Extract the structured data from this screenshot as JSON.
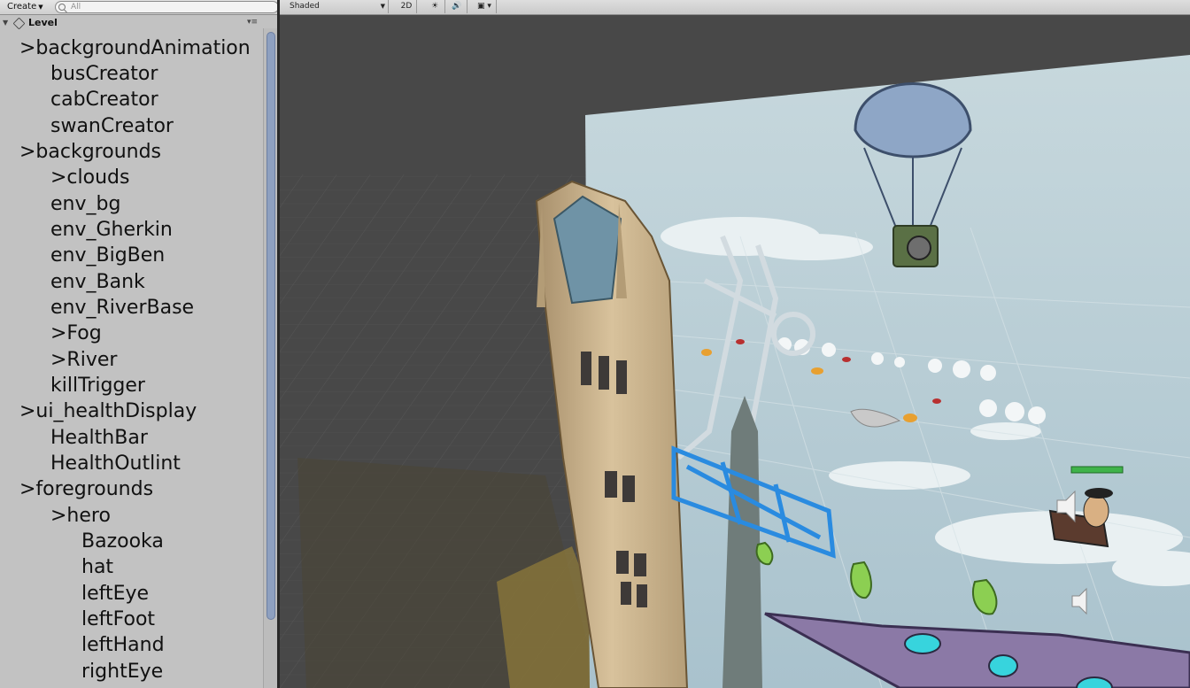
{
  "hierarchy": {
    "create_label": "Create",
    "search_placeholder": "All",
    "scene_name": "Level",
    "items": [
      {
        "label": ">backgroundAnimation"
      },
      {
        "label": "busCreator"
      },
      {
        "label": "cabCreator"
      },
      {
        "label": "swanCreator"
      },
      {
        "label": ">backgrounds"
      },
      {
        "label": ">clouds"
      },
      {
        "label": "env_bg"
      },
      {
        "label": "env_Gherkin"
      },
      {
        "label": "env_BigBen"
      },
      {
        "label": "env_Bank"
      },
      {
        "label": "env_RiverBase"
      },
      {
        "label": ">Fog"
      },
      {
        "label": ">River"
      },
      {
        "label": "killTrigger"
      },
      {
        "label": ">ui_healthDisplay"
      },
      {
        "label": "HealthBar"
      },
      {
        "label": "HealthOutlint"
      },
      {
        "label": ">foregrounds"
      },
      {
        "label": ">hero"
      },
      {
        "label": "Bazooka"
      },
      {
        "label": "hat"
      },
      {
        "label": "leftEye"
      },
      {
        "label": "leftFoot"
      },
      {
        "label": "leftHand"
      },
      {
        "label": "rightEye"
      }
    ]
  },
  "scene_toolbar": {
    "shading_mode": "Shaded",
    "mode_2d": "2D",
    "lighting_icon": "sun-icon",
    "audio_icon": "speaker-icon",
    "effects_icon": "image-icon"
  },
  "colors": {
    "hierarchy_bg": "#c2c2c2",
    "scene_bg": "#484848",
    "sky": "#b8cdd6",
    "scroll_thumb": "#8ea0c0"
  }
}
